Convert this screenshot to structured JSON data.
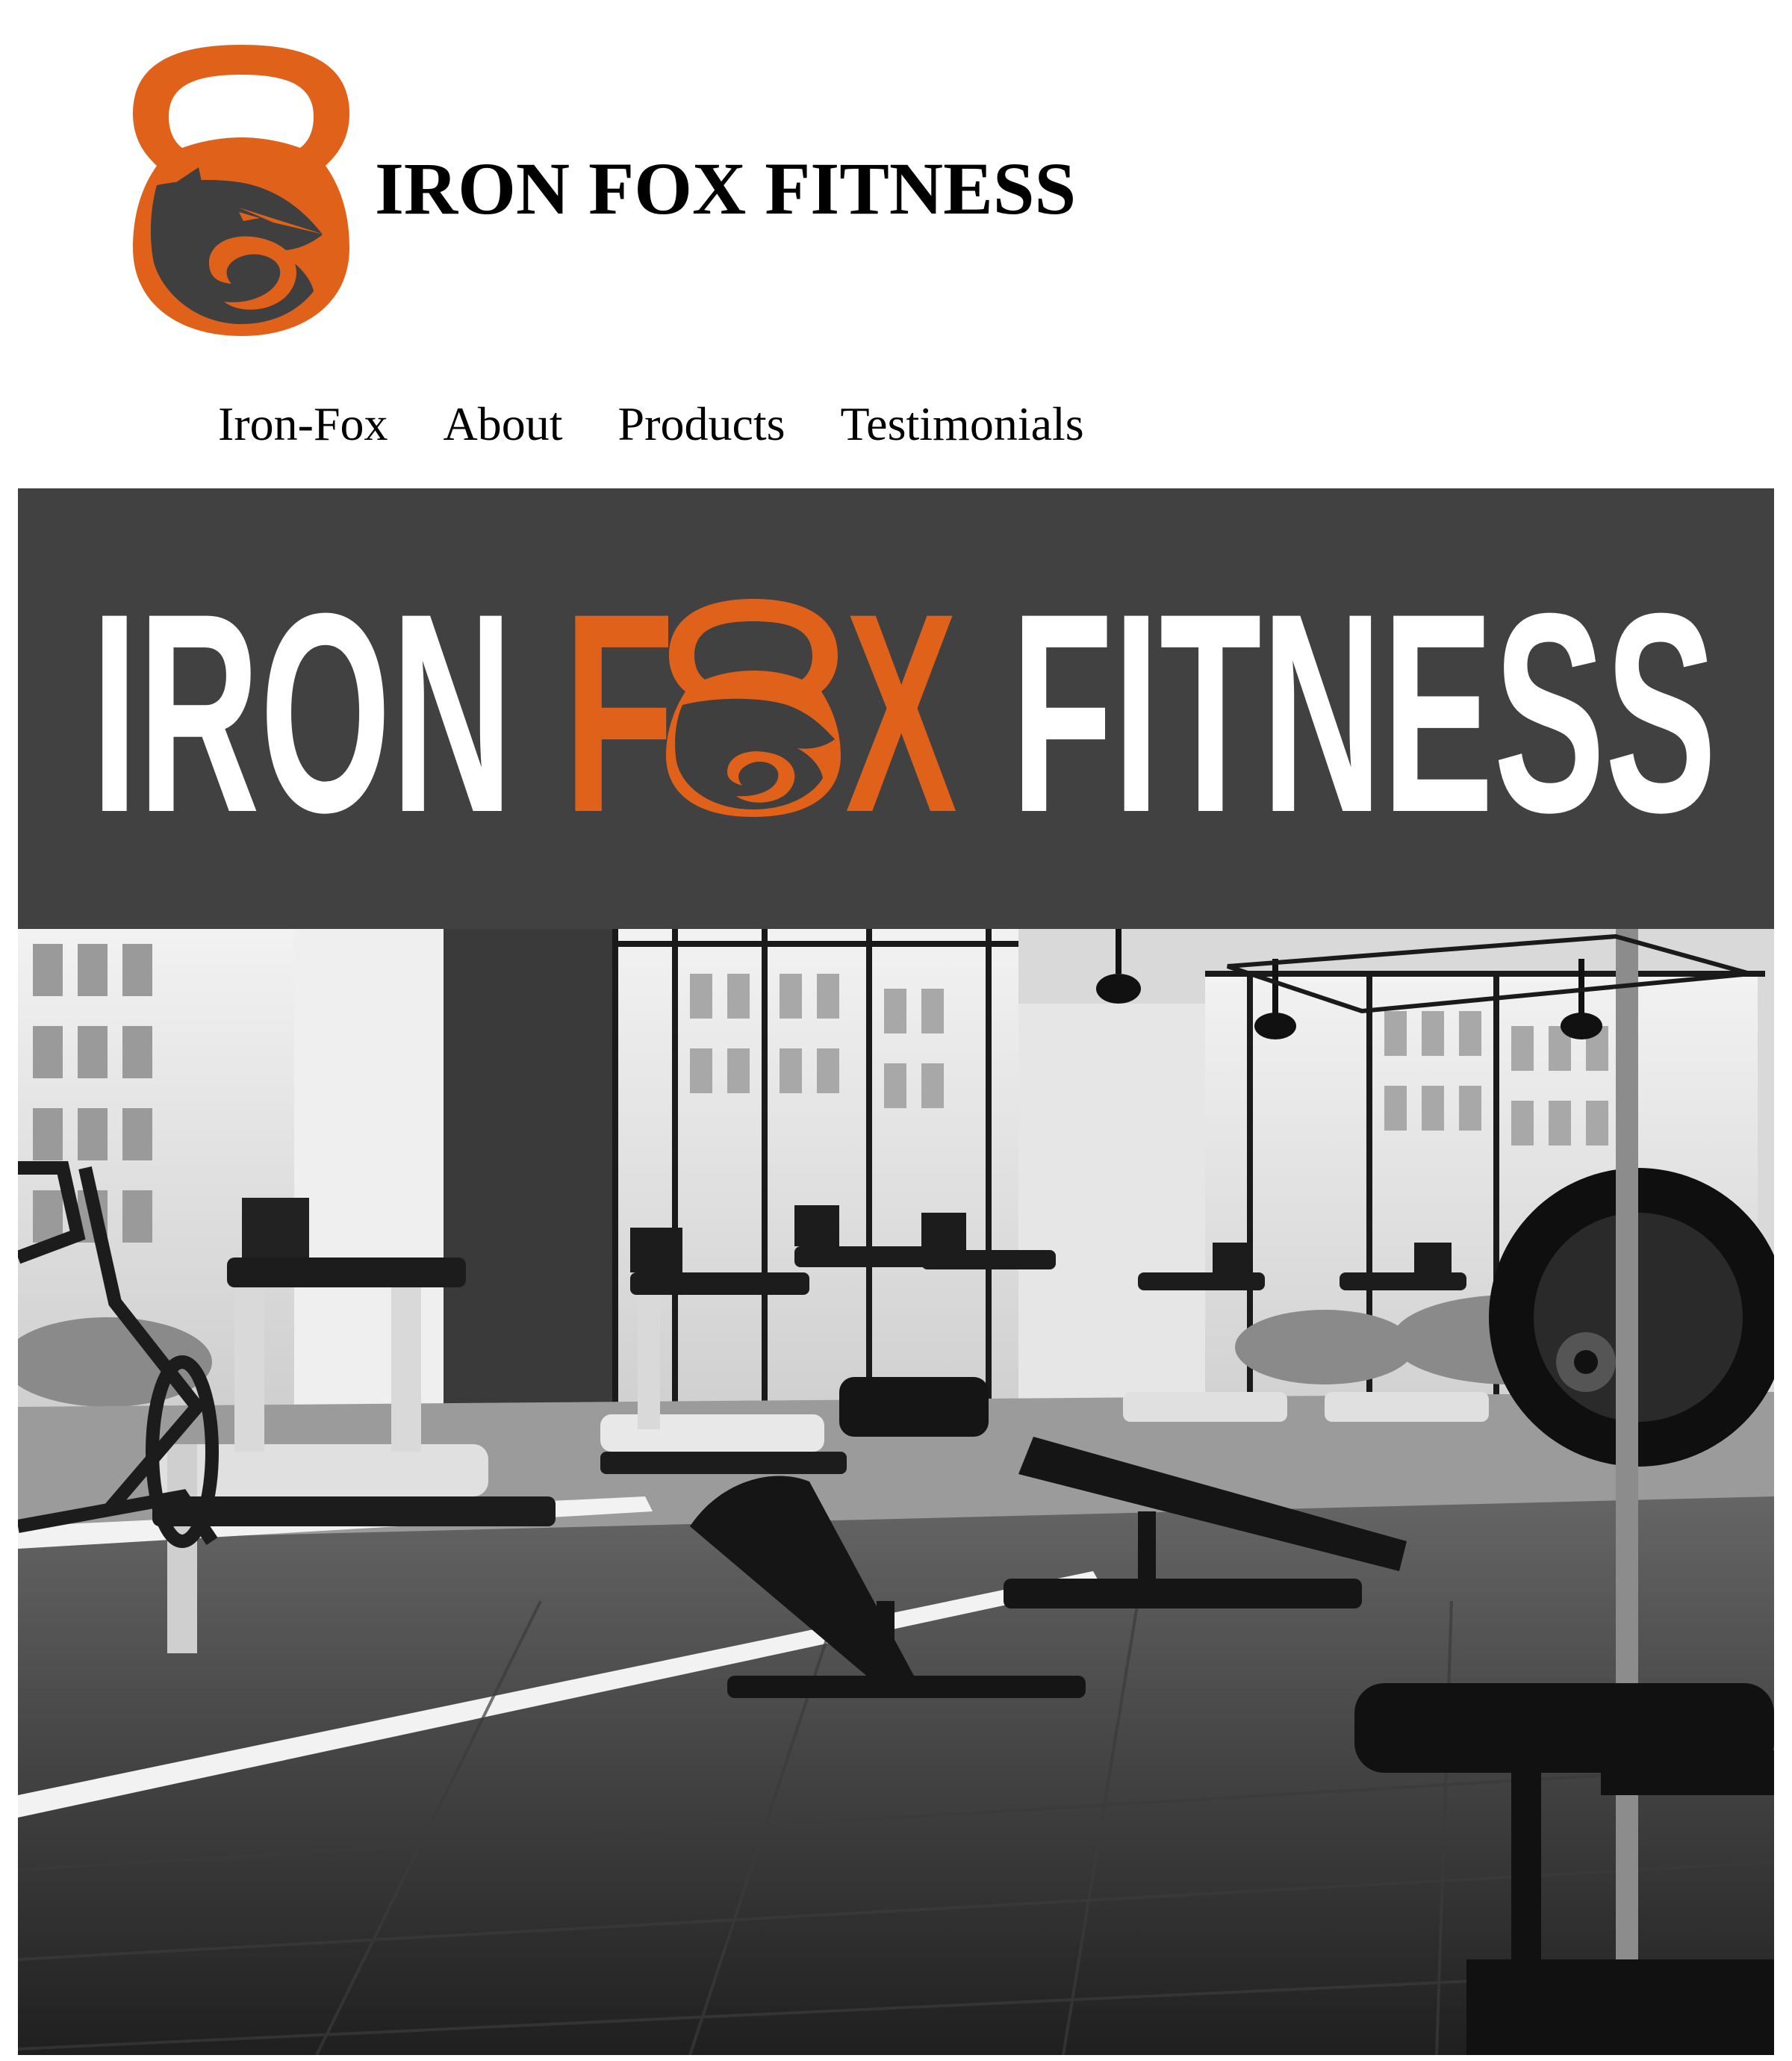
{
  "header": {
    "site_title": "IRON FOX FITNESS"
  },
  "nav": {
    "items": [
      {
        "label": "Iron-Fox"
      },
      {
        "label": "About"
      },
      {
        "label": "Products"
      },
      {
        "label": "Testimonials"
      }
    ]
  },
  "banner": {
    "word_left": "IRON",
    "word_fox_f": "F",
    "word_fox_x": "X",
    "word_right": "FITNESS",
    "background_color": "#414141",
    "accent_color": "#e0621a",
    "text_color": "#ffffff"
  },
  "hero": {
    "image_description_icon": "gym-photo"
  },
  "colors": {
    "brand_orange": "#e0621a",
    "brand_dark": "#3f3f3f"
  }
}
